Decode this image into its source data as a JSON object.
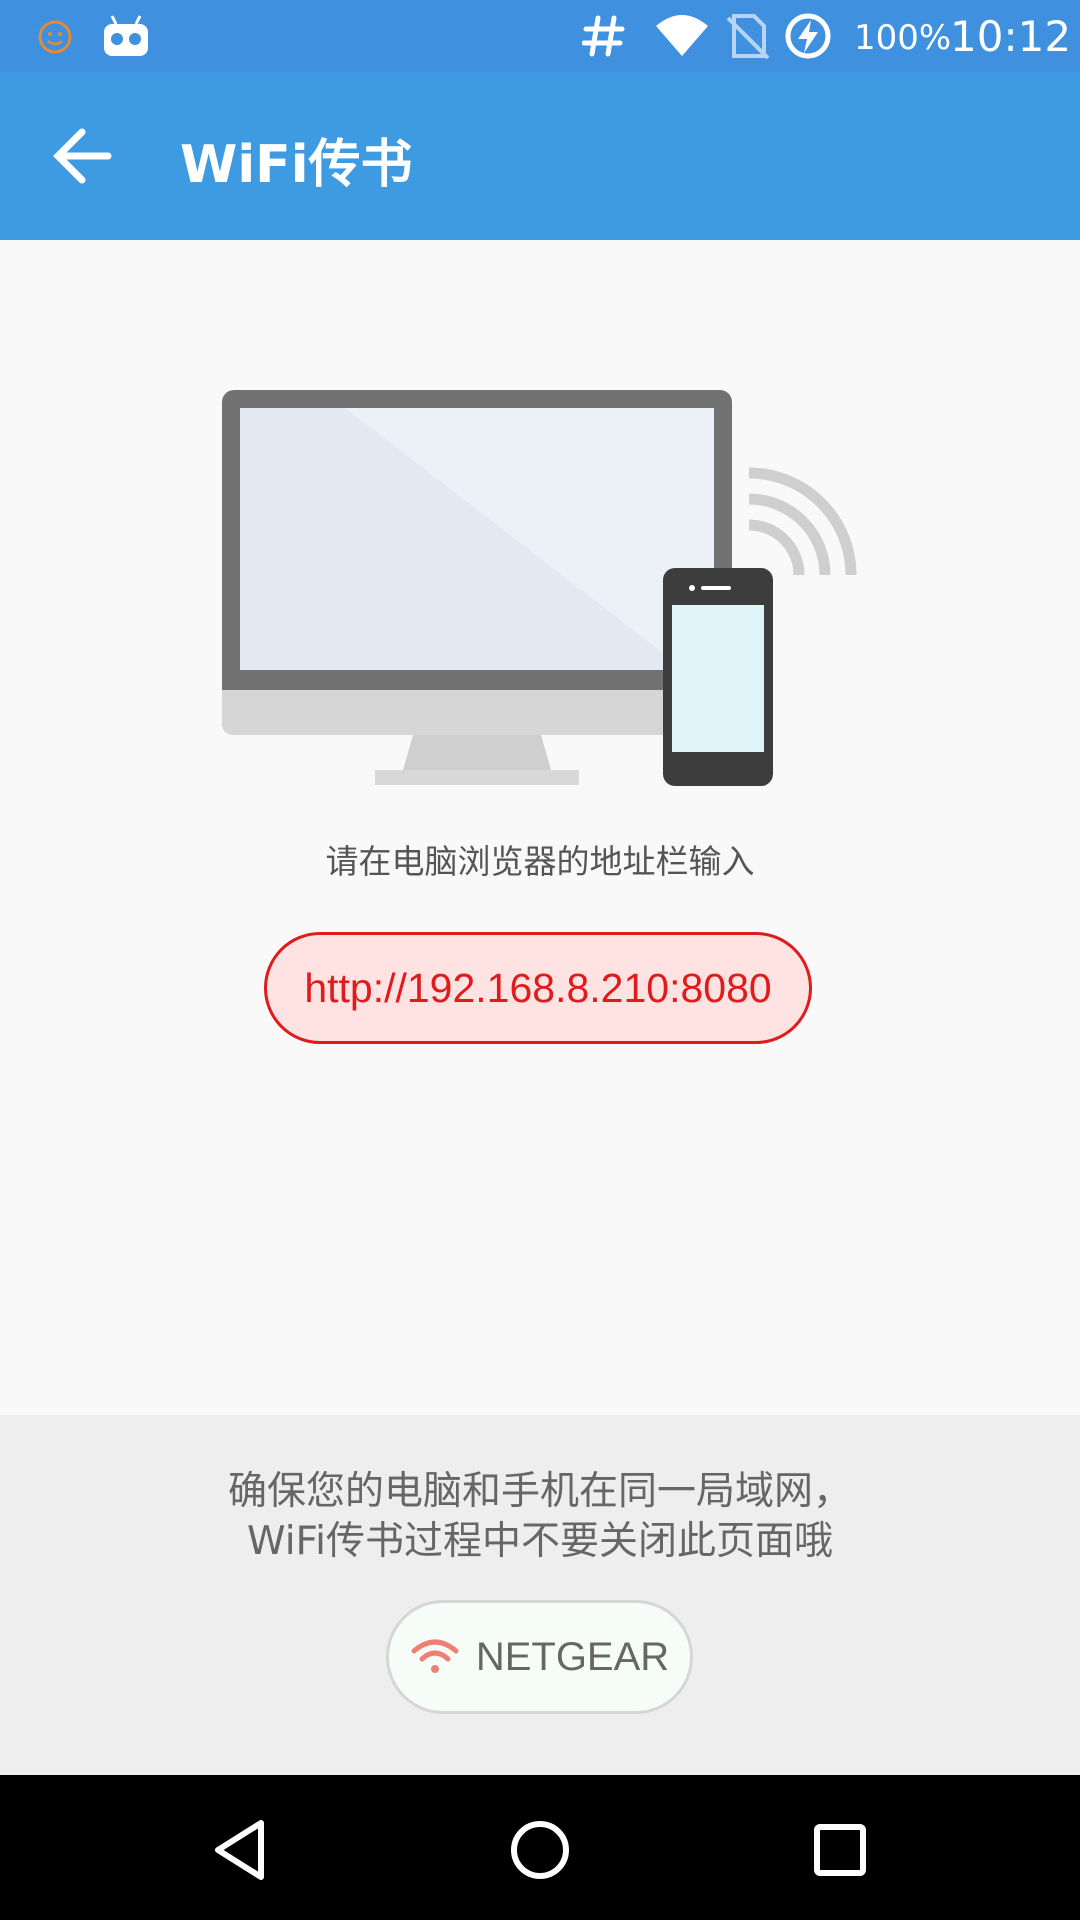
{
  "status_bar": {
    "battery_text": "100%",
    "clock": "10:12",
    "icons": [
      "smiley-icon",
      "robot-icon",
      "hash-icon",
      "wifi-icon",
      "no-sim-icon",
      "charging-icon"
    ]
  },
  "app_bar": {
    "title": "WiFi传书",
    "back_icon": "back-arrow-icon"
  },
  "main": {
    "illustration": "computer-phone-wifi-illustration",
    "instruction": "请在电脑浏览器的地址栏输入",
    "url": "http://192.168.8.210:8080"
  },
  "bottom": {
    "notice_line1": "确保您的电脑和手机在同一局域网，",
    "notice_line2": "WiFi传书过程中不要关闭此页面哦",
    "network_name": "NETGEAR",
    "network_icon": "wifi-icon"
  },
  "nav": {
    "icons": [
      "back-triangle-icon",
      "home-circle-icon",
      "recents-square-icon"
    ]
  },
  "colors": {
    "status_bar": "#3f90df",
    "app_bar": "#3f9be1",
    "url_accent": "#e01b1b",
    "url_bg": "#ffe2e2"
  }
}
